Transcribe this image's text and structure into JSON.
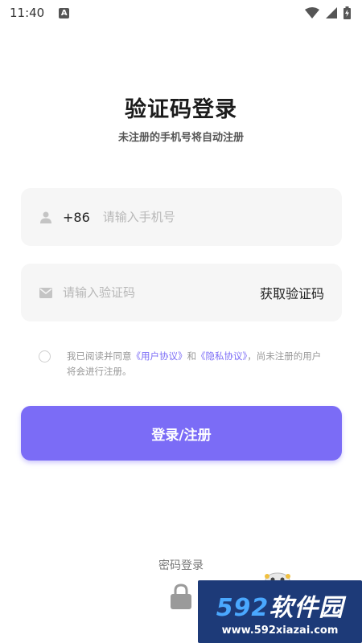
{
  "status_bar": {
    "time": "11:40",
    "notification_icon": "a-letter-icon",
    "wifi_icon": "wifi-icon",
    "signal_icon": "signal-icon",
    "battery_icon": "battery-charging-icon"
  },
  "header": {
    "title": "验证码登录",
    "subtitle": "未注册的手机号将自动注册"
  },
  "phone_field": {
    "icon": "user-icon",
    "prefix": "+86",
    "value": "",
    "placeholder": "请输入手机号"
  },
  "code_field": {
    "icon": "mail-icon",
    "value": "",
    "placeholder": "请输入验证码",
    "get_code_label": "获取验证码"
  },
  "agreement": {
    "checked": false,
    "text_before": "我已阅读并同意",
    "user_agreement": "《用户协议》",
    "and": "和",
    "privacy_agreement": "《隐私协议》",
    "text_after": "，尚未注册的用户将会进行注册。"
  },
  "login_button": {
    "label": "登录/注册"
  },
  "bottom": {
    "password_login_label": "密码登录",
    "lock_icon": "lock-icon"
  },
  "watermark": {
    "brand_number": "592",
    "brand_text": "软件园",
    "url": "www.592xiazai.com"
  },
  "colors": {
    "accent": "#7b6cf6",
    "field_bg": "#f6f6f6",
    "placeholder": "#b8b8b8",
    "watermark_bg": "#1d3a78"
  }
}
